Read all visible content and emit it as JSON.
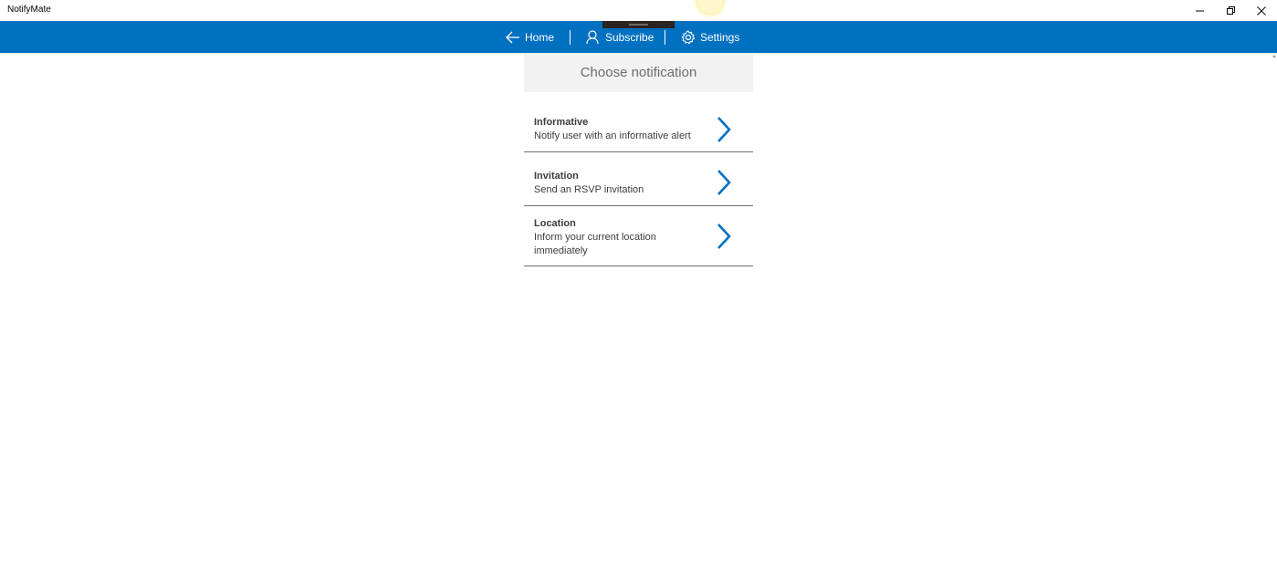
{
  "window": {
    "title": "NotifyMate",
    "controls": {
      "minimize_icon": "minimize-icon",
      "maximize_icon": "restore-icon",
      "close_icon": "close-icon"
    }
  },
  "navbar": {
    "background": "#0070c0",
    "items": [
      {
        "label": "Home",
        "icon": "back-arrow-icon"
      },
      {
        "label": "Subscribe",
        "icon": "person-icon"
      },
      {
        "label": "Settings",
        "icon": "gear-icon"
      }
    ]
  },
  "main": {
    "header": "Choose notification",
    "notifications": [
      {
        "title": "Informative",
        "description": "Notify user with an informative alert",
        "icon": "chevron-right-icon"
      },
      {
        "title": "Invitation",
        "description": "Send an RSVP invitation",
        "icon": "chevron-right-icon"
      },
      {
        "title": "Location",
        "description": "Inform your current location immediately",
        "icon": "chevron-right-icon"
      }
    ]
  },
  "colors": {
    "accent": "#0070c0",
    "header_bg": "#f2f2f2",
    "text": "#3c3c3c"
  }
}
